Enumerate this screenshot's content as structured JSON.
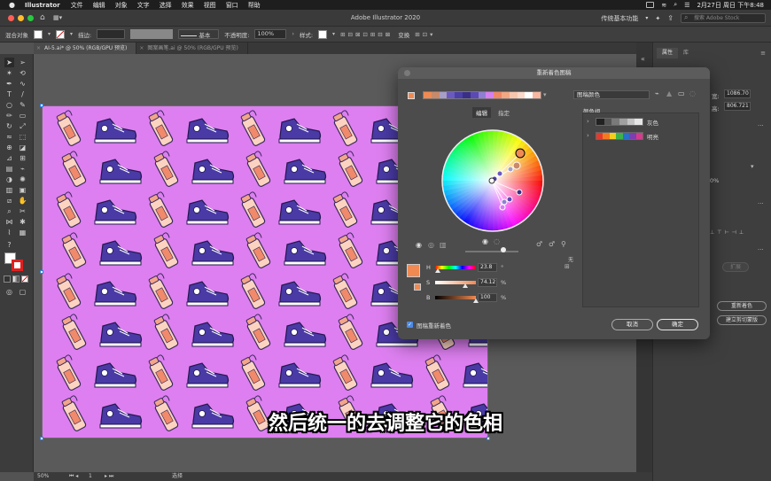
{
  "menubar": {
    "app_name": "Illustrator",
    "items": [
      "文件",
      "编辑",
      "对象",
      "文字",
      "选择",
      "效果",
      "视图",
      "窗口",
      "帮助"
    ],
    "clock": "2月27日 周日 下午8:48"
  },
  "titlebar": {
    "title": "Adobe Illustrator 2020",
    "workspace": "传统基本功能",
    "search_placeholder": "搜索 Adobe Stock"
  },
  "controlbar": {
    "object_type": "混合对象",
    "stroke_label": "描边:",
    "stroke_style": "基本",
    "opacity_label": "不透明度:",
    "opacity_value": "100%",
    "style_label": "样式:",
    "transform_label": "变换"
  },
  "tabs": [
    {
      "label": "AI-5.ai* @ 50% (RGB/GPU 预览)"
    },
    {
      "label": "图案画笔.ai @ 50% (RGB/GPU 预览)"
    }
  ],
  "statusbar": {
    "zoom": "50%",
    "page": "1",
    "tool": "选择"
  },
  "rightpanel": {
    "tab_properties": "属性",
    "tab_layers": "库",
    "width_label": "宽:",
    "width_value": "1086.70",
    "height_label": "高:",
    "height_value": "806.721",
    "percent": "0%",
    "expand_button": "扩展",
    "recolor_button": "重新着色",
    "clipmask_button": "建立剪切蒙版"
  },
  "dialog": {
    "title": "重新着色图稿",
    "harmony_name": "图稿颜色",
    "tab_edit": "编辑",
    "tab_assign": "指定",
    "color_groups_label": "颜色组",
    "groups": [
      {
        "name": "灰色",
        "colors": [
          "#222222",
          "#555555",
          "#7a7a7a",
          "#a0a0a0",
          "#c4c4c4",
          "#e6e6e6"
        ]
      },
      {
        "name": "明亮",
        "colors": [
          "#e23b2e",
          "#f47a20",
          "#f5cd1c",
          "#3db24a",
          "#2a6fc9",
          "#7b3fb0",
          "#d63a8c"
        ]
      }
    ],
    "harmony_colors": [
      "#f08a52",
      "#c98a6a",
      "#a89fc6",
      "#6a5ac0",
      "#4b3fa8",
      "#3a2f86",
      "#5b4ab4",
      "#8f7fd4",
      "#d67ff0",
      "#ee8866",
      "#f2a782",
      "#f7c7ad",
      "#fbd8c8",
      "#ffffff",
      "#f8b6a0"
    ],
    "hsb": [
      {
        "label": "H",
        "value": "23.8",
        "unit": "°",
        "fraction": 0.066
      },
      {
        "label": "S",
        "value": "74.12",
        "unit": "%",
        "fraction": 0.741
      },
      {
        "label": "B",
        "value": "100",
        "unit": "%",
        "fraction": 1.0
      }
    ],
    "current_color": "#f08a52",
    "recolor_checkbox_label": "图稿重新着色",
    "recolor_checked": true,
    "cancel": "取消",
    "ok": "确定",
    "none_label": "无"
  },
  "subtitle": "然后统一的去调整它的色相"
}
